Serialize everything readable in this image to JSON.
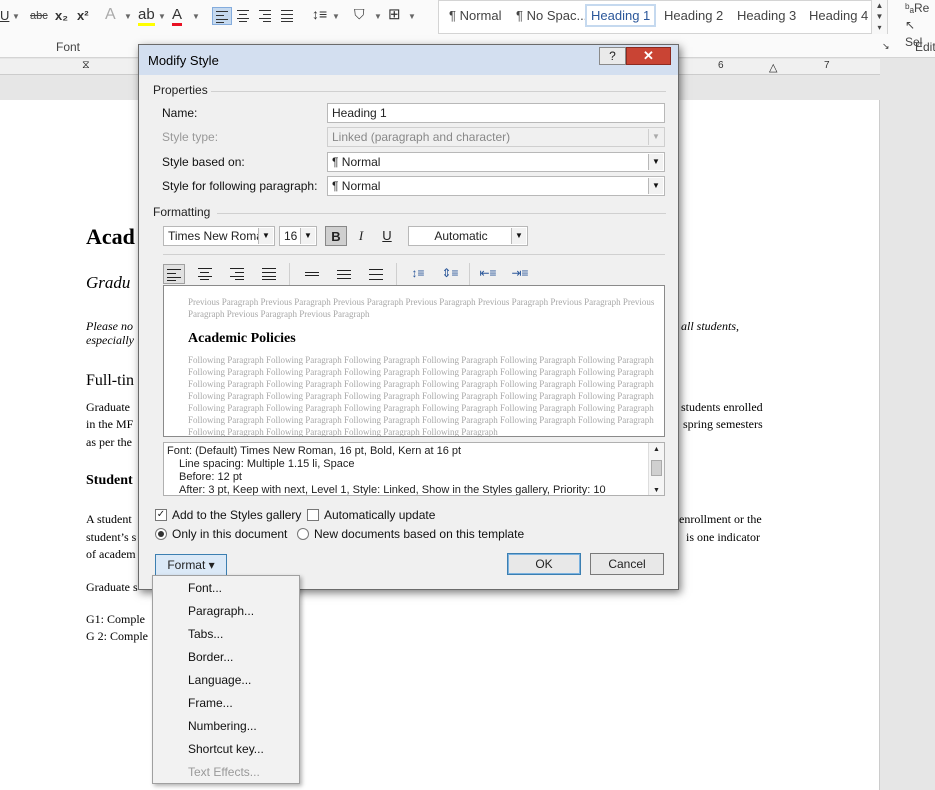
{
  "ribbon": {
    "underline_icon": "U",
    "strikethrough_icon": "abc",
    "subscript_icon": "x₂",
    "superscript_icon": "x²",
    "font_group_label": "Font",
    "editing_group_label": "Edit",
    "styles": [
      "¶ Normal",
      "¶ No Spac...",
      "Heading 1",
      "Heading 2",
      "Heading 3",
      "Heading 4"
    ],
    "selected_style": "Heading 1",
    "replace_label": "Re",
    "select_label": "Sel",
    "ruler_numbers": [
      "6",
      "7"
    ]
  },
  "document": {
    "lines": [
      {
        "text": "Acad",
        "style": "title"
      },
      {
        "text": "Gradu",
        "style": "subtitle"
      },
      {
        "text": "Please no",
        "style": "note"
      },
      {
        "text": "especially",
        "style": "note"
      },
      {
        "text": "all students,",
        "style": "note"
      },
      {
        "text": "Full-tin",
        "style": "heading"
      },
      {
        "text": "Graduate",
        "style": "body"
      },
      {
        "text": "in the MF",
        "style": "body"
      },
      {
        "text": "as per the",
        "style": "body"
      },
      {
        "text": "students enrolled",
        "style": "body"
      },
      {
        "text": "spring semesters",
        "style": "body"
      },
      {
        "text": "Student",
        "style": "subheading"
      },
      {
        "text": "A student",
        "style": "body"
      },
      {
        "text": "student’s s",
        "style": "body"
      },
      {
        "text": "of academ",
        "style": "body"
      },
      {
        "text": "enrollment or the",
        "style": "body"
      },
      {
        "text": "is one indicator",
        "style": "body"
      },
      {
        "text": "Graduate s",
        "style": "body"
      },
      {
        "text": "G1: Comple",
        "style": "body"
      },
      {
        "text": "G 2: Comple",
        "style": "body"
      }
    ]
  },
  "dialog": {
    "title": "Modify Style",
    "help_label": "?",
    "close_label": "✕",
    "properties_label": "Properties",
    "name_label": "Name:",
    "name_value": "Heading 1",
    "style_type_label": "Style type:",
    "style_type_value": "Linked (paragraph and character)",
    "based_on_label": "Style based on:",
    "based_on_value": "¶  Normal",
    "following_label": "Style for following paragraph:",
    "following_value": "¶  Normal",
    "formatting_label": "Formatting",
    "font_name": "Times New Roman",
    "font_size": "16",
    "bold_label": "B",
    "italic_label": "I",
    "underline_label": "U",
    "color_value": "Automatic",
    "preview": {
      "previous_text": "Previous Paragraph Previous Paragraph Previous Paragraph Previous Paragraph Previous Paragraph Previous Paragraph Previous Paragraph Previous Paragraph Previous Paragraph",
      "heading": "Academic Policies",
      "following_text": "Following Paragraph Following Paragraph Following Paragraph Following Paragraph Following Paragraph Following Paragraph Following Paragraph Following Paragraph Following Paragraph Following Paragraph Following Paragraph Following Paragraph Following Paragraph Following Paragraph Following Paragraph Following Paragraph Following Paragraph Following Paragraph Following Paragraph Following Paragraph Following Paragraph Following Paragraph Following Paragraph Following Paragraph Following Paragraph Following Paragraph Following Paragraph Following Paragraph Following Paragraph Following Paragraph Following Paragraph Following Paragraph Following Paragraph Following Paragraph Following Paragraph Following Paragraph Following Paragraph Following Paragraph Following Paragraph Following Paragraph"
    },
    "description": [
      "Font: (Default) Times New Roman, 16 pt, Bold, Kern at 16 pt",
      "Line spacing:  Multiple 1.15 li, Space",
      "Before:  12 pt",
      "After:  3 pt, Keep with next, Level 1, Style: Linked, Show in the Styles gallery, Priority: 10"
    ],
    "add_to_gallery_label": "Add to the Styles gallery",
    "add_to_gallery_checked": true,
    "auto_update_label": "Automatically update",
    "auto_update_checked": false,
    "only_this_doc_label": "Only in this document",
    "new_docs_label": "New documents based on this template",
    "format_button": "Format ▾",
    "ok_button": "OK",
    "cancel_button": "Cancel"
  },
  "format_menu": {
    "items": [
      {
        "label": "Font...",
        "enabled": true
      },
      {
        "label": "Paragraph...",
        "enabled": true
      },
      {
        "label": "Tabs...",
        "enabled": true
      },
      {
        "label": "Border...",
        "enabled": true
      },
      {
        "label": "Language...",
        "enabled": true
      },
      {
        "label": "Frame...",
        "enabled": true
      },
      {
        "label": "Numbering...",
        "enabled": true
      },
      {
        "label": "Shortcut key...",
        "enabled": true
      },
      {
        "label": "Text Effects...",
        "enabled": false
      }
    ]
  },
  "colors": {
    "accent": "#2b579a",
    "title_bar": "#d3dff0",
    "close_button": "#c94434",
    "highlight": "#ffff00",
    "font_color": "#e81123"
  }
}
